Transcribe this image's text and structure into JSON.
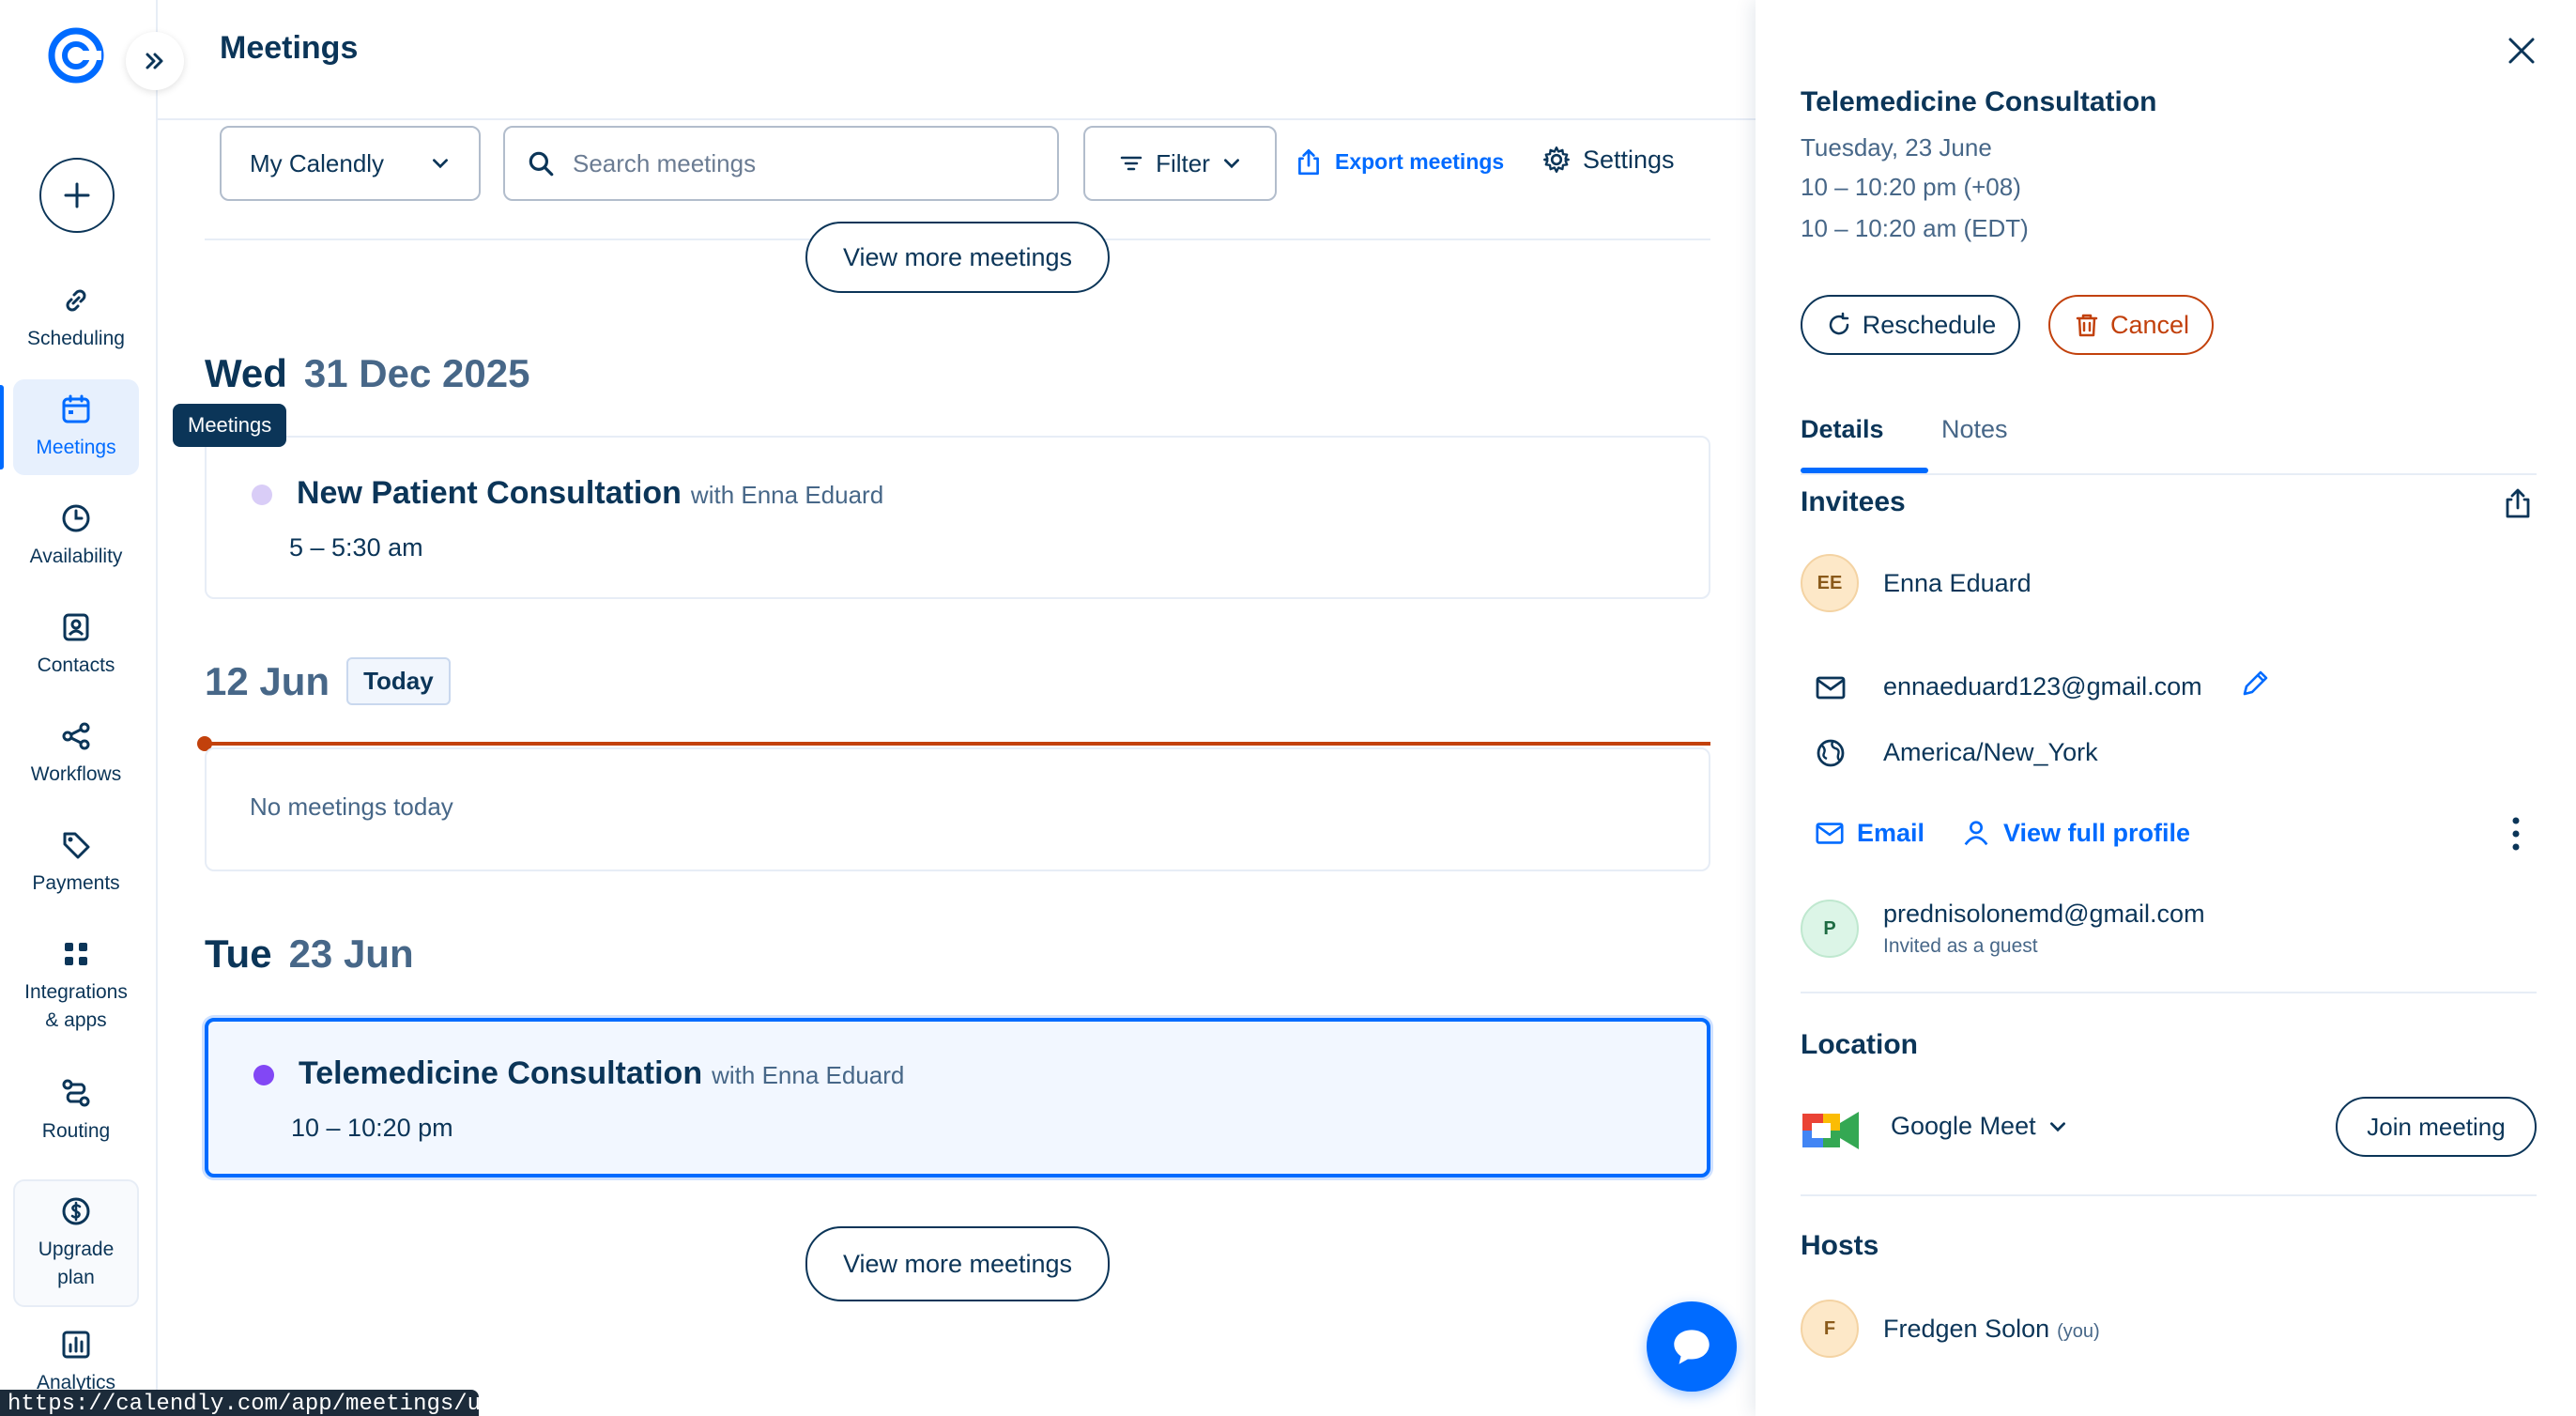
{
  "app": {
    "title": "Meetings"
  },
  "sidebar": {
    "items": [
      {
        "label": "Scheduling"
      },
      {
        "label": "Meetings"
      },
      {
        "label": "Availability"
      },
      {
        "label": "Contacts"
      },
      {
        "label": "Workflows"
      },
      {
        "label": "Payments"
      },
      {
        "label": "Integrations & apps"
      },
      {
        "label": "Routing"
      },
      {
        "label": "Upgrade plan"
      },
      {
        "label": "Analytics"
      }
    ],
    "tooltip": "Meetings",
    "accent": "#006bff"
  },
  "toolbar": {
    "calendar_select": "My Calendly",
    "search_placeholder": "Search meetings",
    "filter_label": "Filter",
    "export_label": "Export meetings",
    "settings_label": "Settings"
  },
  "main": {
    "view_more_label": "View more meetings",
    "days": [
      {
        "dow": "Wed",
        "date": "31 Dec 2025",
        "meetings": [
          {
            "title": "New Patient Consultation",
            "with": "with Enna Eduard",
            "time": "5 – 5:30 am",
            "color": "#d9cdf7"
          }
        ]
      },
      {
        "dow": "",
        "date": "12 Jun",
        "badge": "Today",
        "empty_text": "No meetings today"
      },
      {
        "dow": "Tue",
        "date": "23 Jun",
        "meetings": [
          {
            "title": "Telemedicine Consultation",
            "with": "with Enna Eduard",
            "time": "10 – 10:20 pm",
            "color": "#8247f5"
          }
        ]
      }
    ]
  },
  "status_bar": {
    "url": "https://calendly.com/app/meetings/user/me"
  },
  "panel": {
    "title": "Telemedicine Consultation",
    "date": "Tuesday, 23 June",
    "time_local": "10 – 10:20 pm (+08)",
    "time_edt": "10 – 10:20 am (EDT)",
    "reschedule_label": "Reschedule",
    "cancel_label": "Cancel",
    "tabs": [
      {
        "label": "Details"
      },
      {
        "label": "Notes"
      }
    ],
    "invitees_title": "Invitees",
    "invitee": {
      "initials": "EE",
      "name": "Enna Eduard",
      "email": "ennaeduard123@gmail.com",
      "timezone": "America/New_York",
      "email_action": "Email",
      "profile_action": "View full profile"
    },
    "guest": {
      "initials": "P",
      "email": "prednisolonemd@gmail.com",
      "note": "Invited as a guest"
    },
    "location_title": "Location",
    "location": {
      "name": "Google Meet",
      "join_label": "Join meeting"
    },
    "hosts_title": "Hosts",
    "host": {
      "initials": "F",
      "name": "Fredgen Solon",
      "tag": "(you)"
    }
  }
}
